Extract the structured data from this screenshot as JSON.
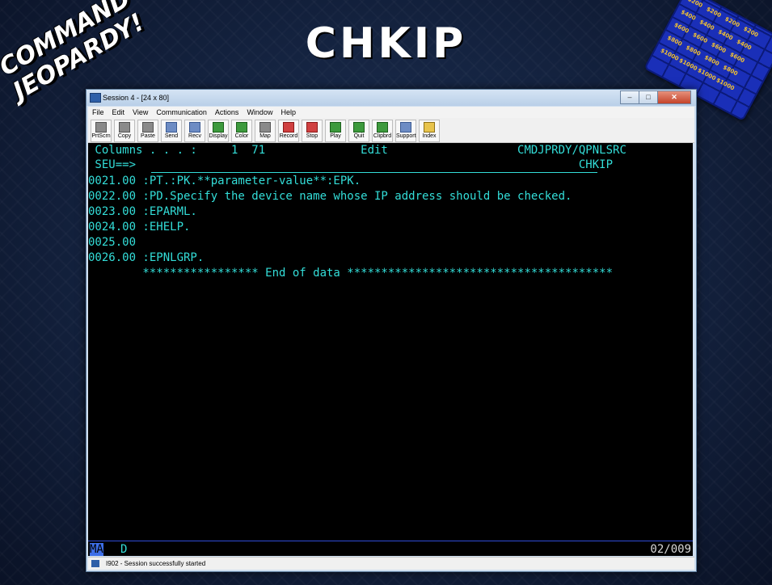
{
  "slide": {
    "title": "CHKIP",
    "logo_text": "COMMAND JEOPARDY!",
    "board_values": [
      "$200",
      "$400",
      "$600",
      "$800",
      "$1000"
    ]
  },
  "window": {
    "title": "Session 4 - [24 x 80]",
    "controls": [
      "minimize",
      "maximize",
      "close"
    ]
  },
  "menu": [
    "File",
    "Edit",
    "View",
    "Communication",
    "Actions",
    "Window",
    "Help"
  ],
  "toolbar": [
    {
      "label": "PrtScrn",
      "icon": "print-screen-icon"
    },
    {
      "label": "Copy",
      "icon": "copy-icon"
    },
    {
      "label": "Paste",
      "icon": "paste-icon"
    },
    {
      "label": "Send",
      "icon": "send-icon"
    },
    {
      "label": "Recv",
      "icon": "receive-icon"
    },
    {
      "label": "Display",
      "icon": "display-icon"
    },
    {
      "label": "Color",
      "icon": "color-icon"
    },
    {
      "label": "Map",
      "icon": "map-icon"
    },
    {
      "label": "Record",
      "icon": "record-icon"
    },
    {
      "label": "Stop",
      "icon": "stop-icon"
    },
    {
      "label": "Play",
      "icon": "play-icon"
    },
    {
      "label": "Quit",
      "icon": "quit-icon"
    },
    {
      "label": "Clipbrd",
      "icon": "clipboard-icon"
    },
    {
      "label": "Support",
      "icon": "support-icon"
    },
    {
      "label": "Index",
      "icon": "index-icon"
    }
  ],
  "terminal": {
    "header": " Columns . . . :     1  71              Edit                   CMDJPRDY/QPNLSRC",
    "seu": " SEU==>                                                                 CHKIP",
    "lines": [
      "0021.00 :PT.:PK.**parameter-value**:EPK.",
      "0022.00 :PD.Specify the device name whose IP address should be checked.",
      "0023.00 :EPARML.",
      "0024.00 :EHELP.",
      "0025.00",
      "0026.00 :EPNLGRP.",
      "        ***************** End of data ***************************************"
    ],
    "status_mode": "MA",
    "status_flag": "D",
    "status_pos": "02/009"
  },
  "statusbar": {
    "text": "I902 - Session successfully started"
  }
}
